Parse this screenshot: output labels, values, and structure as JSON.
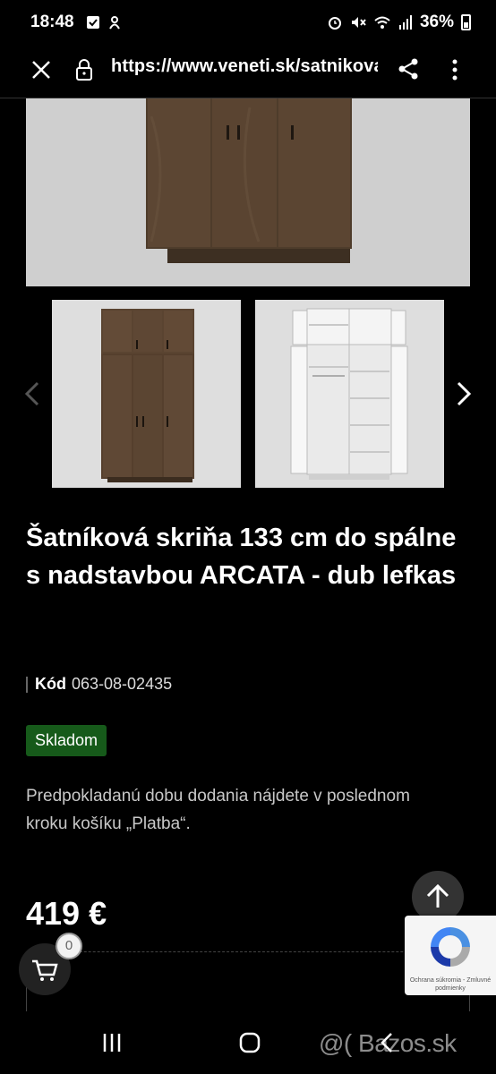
{
  "status_bar": {
    "time": "18:48",
    "battery": "36%"
  },
  "browser": {
    "url": "https://www.veneti.sk/satnikova-skrina"
  },
  "gallery": {
    "main_image_alt": "wardrobe-front",
    "thumbnails": [
      "wardrobe-dark-oak",
      "wardrobe-white-open"
    ]
  },
  "product": {
    "title": "Šatníková skriňa 133 cm do spálne s nadstavbou ARCATA - dub lefkas",
    "code_label": "Kód",
    "code_value": "063-08-02435",
    "stock_badge": "Skladom",
    "delivery_note": "Predpokladanú dobu dodania nájdete v poslednom kroku košíku „Platba“.",
    "price": "419 €"
  },
  "cart": {
    "count": "0"
  },
  "recaptcha": {
    "text": "Ochrana súkromia - Zmluvné podmienky"
  },
  "watermark": "@( Bazos.sk",
  "colors": {
    "background": "#000000",
    "stock_badge": "#165a1a",
    "main_image_bg": "#d0d0d0"
  }
}
